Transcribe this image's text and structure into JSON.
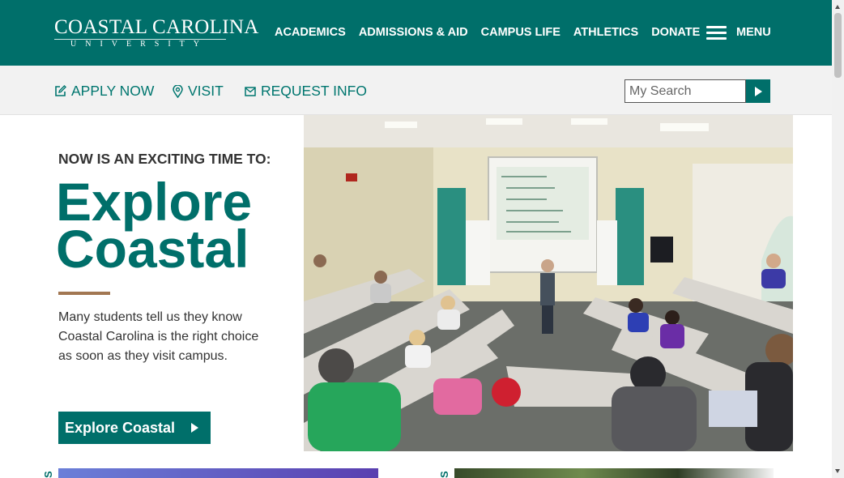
{
  "logo": {
    "name": "COASTAL CAROLINA",
    "sub": "UNIVERSITY"
  },
  "nav": {
    "items": [
      "ACADEMICS",
      "ADMISSIONS & AID",
      "CAMPUS LIFE",
      "ATHLETICS",
      "DONATE"
    ],
    "menu_label": "MENU"
  },
  "subnav": {
    "apply": "APPLY NOW",
    "visit": "VISIT",
    "request": "REQUEST INFO"
  },
  "search": {
    "placeholder": "My Search"
  },
  "hero": {
    "eyebrow": "NOW IS AN EXCITING TIME TO:",
    "headline_line1": "Explore",
    "headline_line2": "Coastal",
    "intro": "Many students tell us they know Coastal Carolina is the right choice as soon as they visit campus.",
    "cta_label": "Explore Coastal",
    "photo_icon": "classroom-photo"
  },
  "lower": {
    "card1_label": "S",
    "card2_label": "S"
  },
  "colors": {
    "brand_teal": "#006f6a",
    "bronze": "#a27752",
    "subbar_bg": "#f2f2f2"
  }
}
